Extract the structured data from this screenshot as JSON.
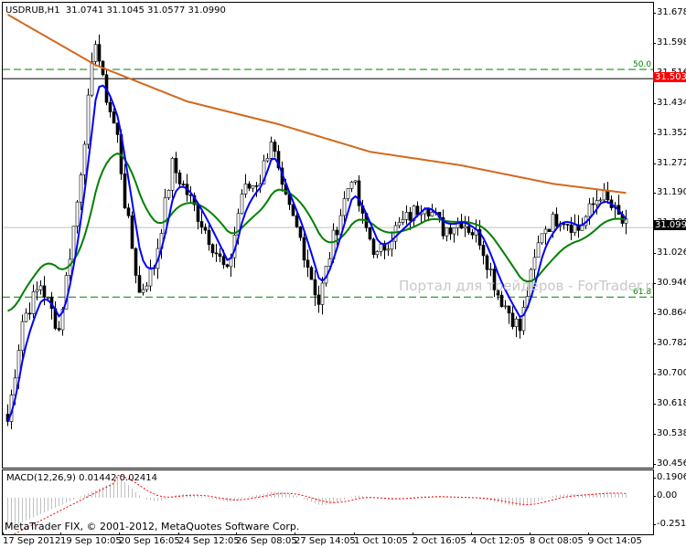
{
  "header": {
    "symbol": "USDRUB,H1",
    "ohlc": "31.0741 31.1045 31.0577 31.0990"
  },
  "watermark": "Портал для трейдеров - ForTrader.ru",
  "copyright": "MetaTrader FIX, © 2001-2012, MetaQuotes Software Corp.",
  "macd": {
    "label": "MACD(12,26,9) 0.01442 0.02414",
    "scale": [
      "0.1906",
      "0.00",
      "-0.2515"
    ]
  },
  "price_scale": [
    "31.6780",
    "31.5980",
    "31.5160",
    "31.4340",
    "31.3520",
    "31.2720",
    "31.1900",
    "31.1080",
    "31.0260",
    "30.9460",
    "30.8640",
    "30.7820",
    "30.7000",
    "30.6180",
    "30.5380",
    "30.4560"
  ],
  "tags": {
    "red_line": "31.5038",
    "current": "31.0990"
  },
  "fibo": {
    "level_50": "50.0",
    "level_618": "61.8",
    "price_50": 31.529,
    "price_618": 30.91
  },
  "time_axis": [
    "17 Sep 2012",
    "19 Sep 10:05",
    "20 Sep 16:05",
    "24 Sep 12:05",
    "26 Sep 08:05",
    "27 Sep 14:05",
    "1 Oct 10:05",
    "2 Oct 16:05",
    "4 Oct 12:05",
    "8 Oct 08:05",
    "9 Oct 14:05"
  ],
  "colors": {
    "ma_long": "#d2691e",
    "ma_fast": "#0000ff",
    "ma_mid": "#008000",
    "macd_signal": "#ff0000",
    "red_line": "#ff0000",
    "fibo": "#008000"
  },
  "chart_data": {
    "type": "candlestick",
    "price_range": [
      30.456,
      31.678
    ],
    "bars": 170,
    "close_anchors": [
      [
        0,
        30.572
      ],
      [
        4,
        30.846
      ],
      [
        9,
        30.945
      ],
      [
        14,
        30.821
      ],
      [
        19,
        31.169
      ],
      [
        24,
        31.616
      ],
      [
        26,
        31.492
      ],
      [
        30,
        31.343
      ],
      [
        32,
        31.169
      ],
      [
        36,
        30.92
      ],
      [
        40,
        30.995
      ],
      [
        45,
        31.268
      ],
      [
        49,
        31.193
      ],
      [
        54,
        31.094
      ],
      [
        60,
        30.97
      ],
      [
        64,
        31.193
      ],
      [
        69,
        31.231
      ],
      [
        72,
        31.343
      ],
      [
        75,
        31.193
      ],
      [
        80,
        31.069
      ],
      [
        85,
        30.895
      ],
      [
        89,
        31.069
      ],
      [
        94,
        31.243
      ],
      [
        97,
        31.119
      ],
      [
        101,
        31.019
      ],
      [
        106,
        31.094
      ],
      [
        114,
        31.169
      ],
      [
        119,
        31.094
      ],
      [
        124,
        31.119
      ],
      [
        129,
        31.069
      ],
      [
        134,
        30.92
      ],
      [
        140,
        30.821
      ],
      [
        142,
        30.92
      ],
      [
        146,
        31.094
      ],
      [
        151,
        31.131
      ],
      [
        156,
        31.094
      ],
      [
        162,
        31.193
      ],
      [
        169,
        31.099
      ]
    ],
    "ma_long_anchors": [
      [
        0,
        31.678
      ],
      [
        24,
        31.541
      ],
      [
        49,
        31.442
      ],
      [
        74,
        31.38
      ],
      [
        99,
        31.305
      ],
      [
        124,
        31.268
      ],
      [
        149,
        31.218
      ],
      [
        169,
        31.193
      ]
    ]
  }
}
